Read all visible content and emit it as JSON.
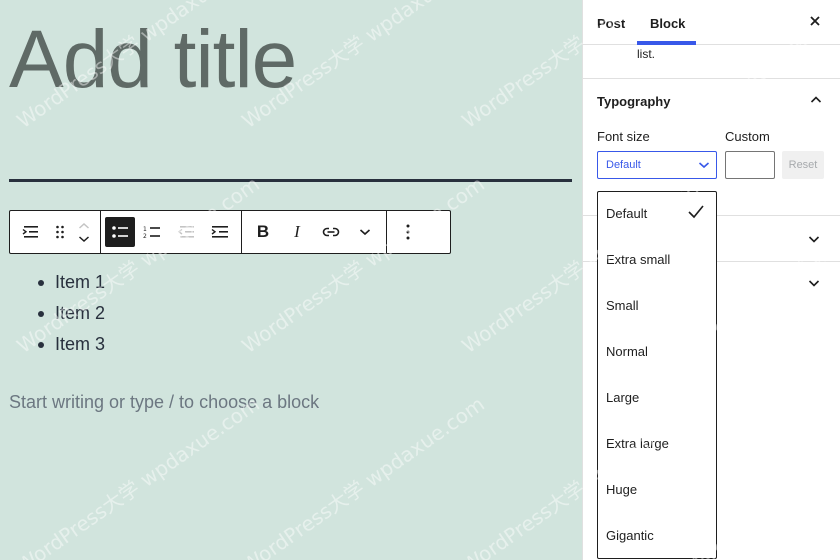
{
  "editor": {
    "title_placeholder": "Add title",
    "list_items": [
      "Item 1",
      "Item 2",
      "Item 3"
    ],
    "block_placeholder": "Start writing or type / to choose a block"
  },
  "toolbar": {
    "icons": [
      "list-block-icon",
      "drag-handle-icon",
      "move-up-icon",
      "move-down-icon",
      "unordered-list-icon",
      "ordered-list-icon",
      "outdent-icon",
      "indent-icon",
      "bold-icon",
      "italic-icon",
      "link-icon",
      "more-rich-text-icon",
      "options-icon"
    ]
  },
  "sidebar": {
    "tabs": {
      "post": "Post",
      "block": "Block"
    },
    "block_description_tail": "list.",
    "typography": {
      "title": "Typography",
      "font_size_label": "Font size",
      "custom_label": "Custom",
      "selected": "Default",
      "reset_label": "Reset"
    },
    "font_size_options": [
      "Default",
      "Extra small",
      "Small",
      "Normal",
      "Large",
      "Extra large",
      "Huge",
      "Gigantic"
    ],
    "selected_option_index": 0
  },
  "watermark": "WordPress大学 wpdaxue.com",
  "colors": {
    "canvas_bg": "#d1e4dd",
    "accent": "#3858e9",
    "text_dark": "#1e1e1e"
  }
}
